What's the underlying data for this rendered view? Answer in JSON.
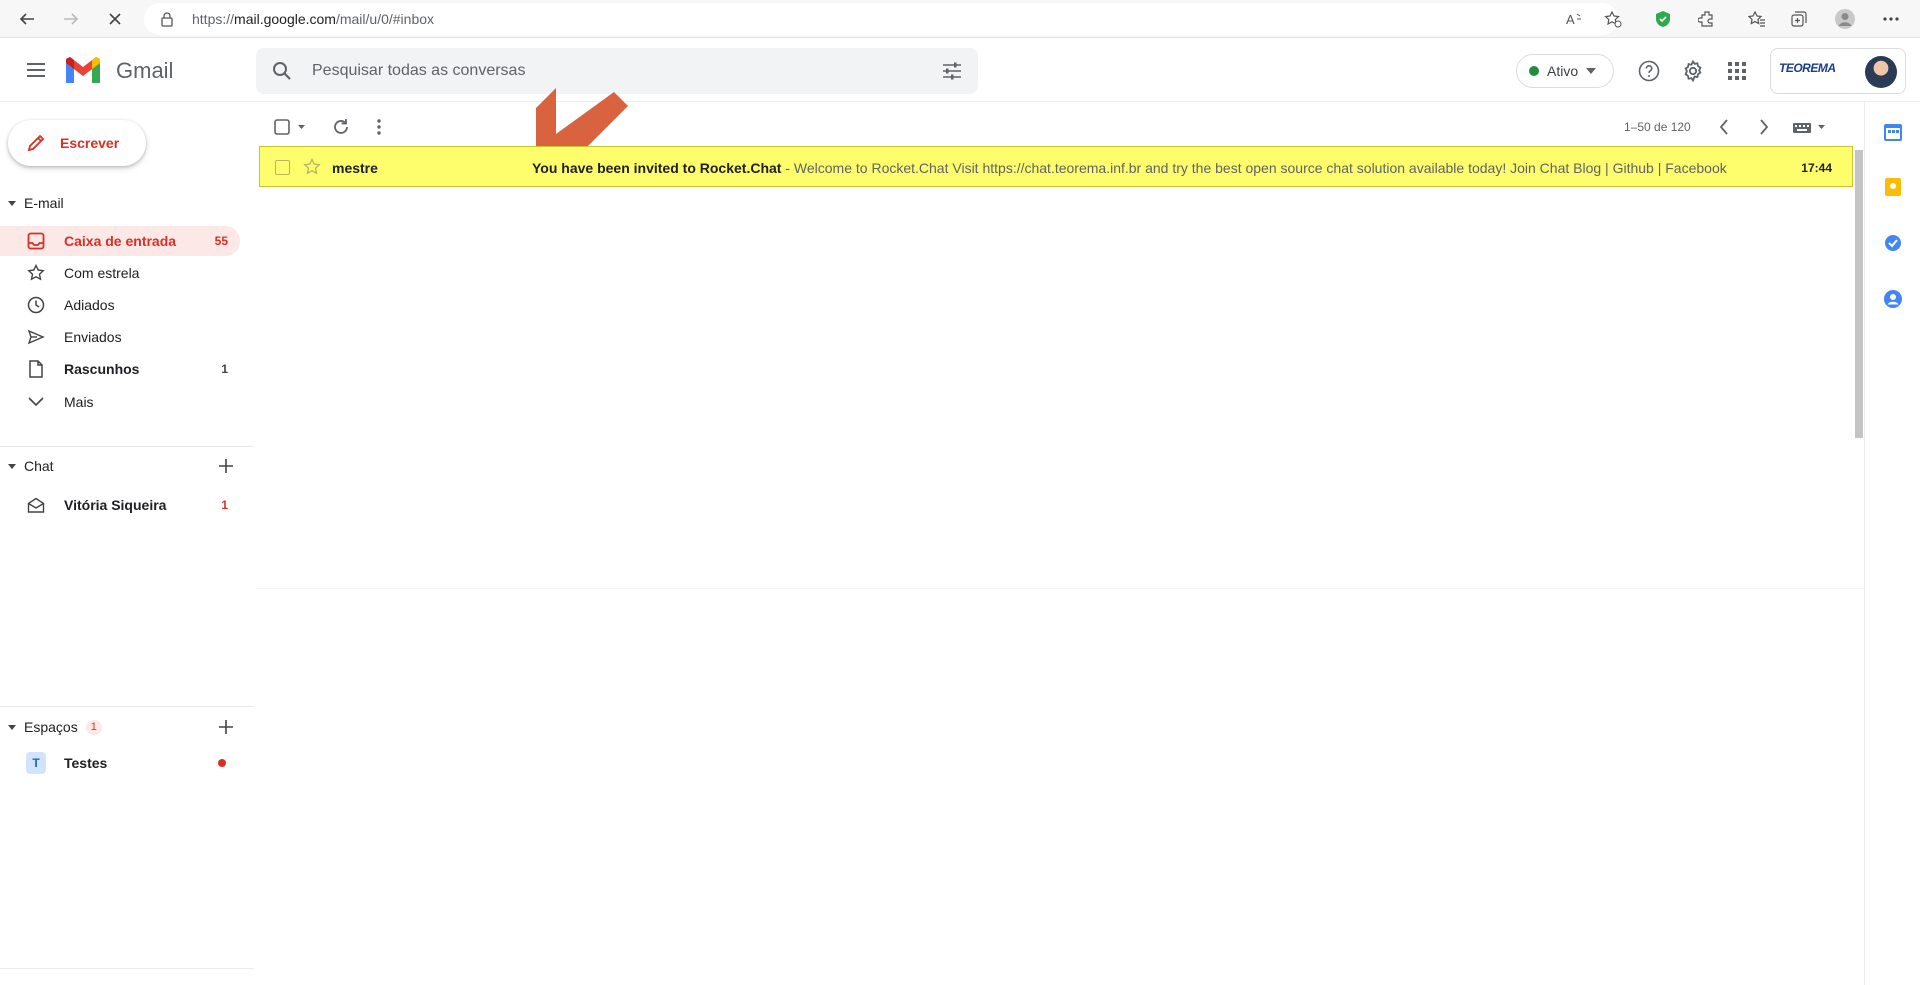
{
  "browser": {
    "url_prefix": "https://",
    "url_domain": "mail.google.com",
    "url_path": "/mail/u/0/#inbox"
  },
  "header": {
    "app_name": "Gmail",
    "search_placeholder": "Pesquisar todas as conversas",
    "status_label": "Ativo",
    "org_name": "TEOREMA"
  },
  "sidebar": {
    "compose_label": "Escrever",
    "mail_section": "E-mail",
    "items": [
      {
        "label": "Caixa de entrada",
        "count": "55"
      },
      {
        "label": "Com estrela",
        "count": ""
      },
      {
        "label": "Adiados",
        "count": ""
      },
      {
        "label": "Enviados",
        "count": ""
      },
      {
        "label": "Rascunhos",
        "count": "1"
      },
      {
        "label": "Mais",
        "count": ""
      }
    ],
    "chat_section": "Chat",
    "chat_items": [
      {
        "label": "Vitória Siqueira",
        "count": "1"
      }
    ],
    "spaces_section": "Espaços",
    "spaces_badge": "1",
    "spaces_items": [
      {
        "initial": "T",
        "label": "Testes"
      }
    ]
  },
  "toolbar": {
    "page_info": "1–50 de 120"
  },
  "emails": [
    {
      "sender": "mestre",
      "subject": "You have been invited to Rocket.Chat",
      "separator": " - ",
      "snippet": "Welcome to Rocket.Chat Visit https://chat.teorema.inf.br and try the best open source chat solution available today! Join Chat Blog | Github | Facebook",
      "time": "17:44"
    }
  ],
  "colors": {
    "accent_red": "#d93025",
    "highlight_row": "#fefd6c",
    "arrow": "#d9623f",
    "active_green": "#1e8e3e"
  }
}
